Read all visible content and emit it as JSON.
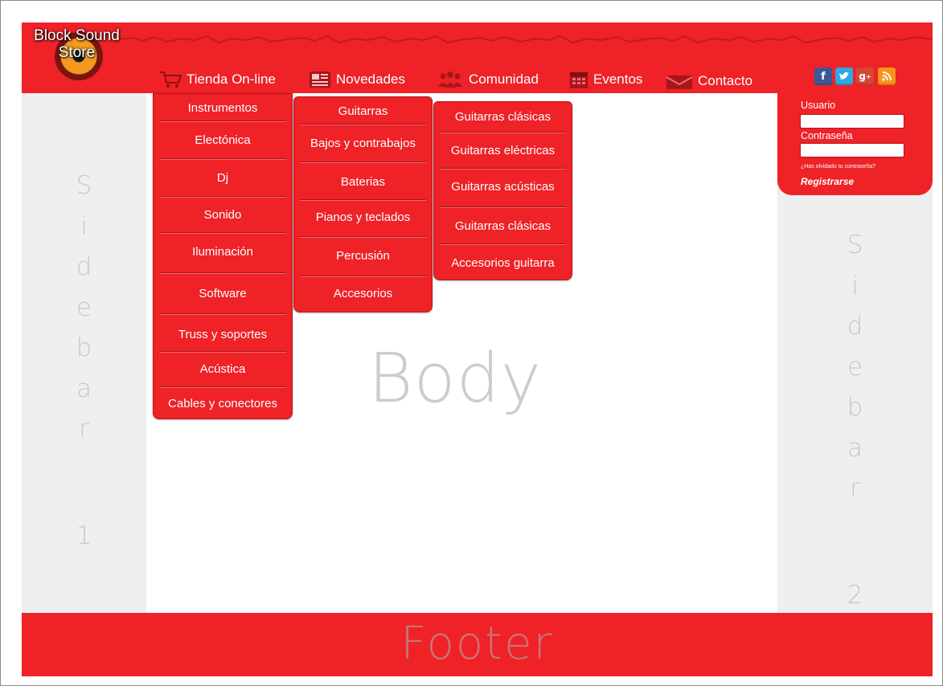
{
  "header": {
    "logo_line1": "Block Sound",
    "logo_line2": "Store",
    "nav": [
      {
        "label": "Tienda On-line",
        "icon": "shopping-cart-icon"
      },
      {
        "label": "Novedades",
        "icon": "newspaper-icon"
      },
      {
        "label": "Comunidad",
        "icon": "people-icon"
      },
      {
        "label": "Eventos",
        "icon": "calendar-icon"
      },
      {
        "label": "Contacto",
        "icon": "envelope-icon"
      }
    ],
    "social": [
      {
        "glyph": "f",
        "icon": "facebook-icon",
        "color": "#3b5998"
      },
      {
        "glyph": "t",
        "icon": "twitter-icon",
        "color": "#2ba9e1"
      },
      {
        "glyph": "g+",
        "icon": "google-plus-icon",
        "color": "#d34836"
      },
      {
        "glyph": "rss",
        "icon": "rss-icon",
        "color": "#f7941d"
      }
    ]
  },
  "menus": {
    "categories": [
      "Instrumentos",
      "Electónica",
      "Dj",
      "Sonido",
      "Iluminación",
      "Software",
      "Truss y soportes",
      "Acústica",
      "Cables y conectores"
    ],
    "instruments": [
      "Guitarras",
      "Bajos y contrabajos",
      "Baterias",
      "Pianos y teclados",
      "Percusión",
      "Accesorios"
    ],
    "guitars": [
      "Guitarras clásicas",
      "Guitarras eléctricas",
      "Guitarras acústicas",
      "Guitarras clásicas",
      "Accesorios guitarra"
    ]
  },
  "login": {
    "user_label": "Usuario",
    "password_label": "Contraseña",
    "forgot": "¿Has olvidado tu contraseña?",
    "register": "Registrarse"
  },
  "sidebar1": [
    "S",
    "i",
    "d",
    "e",
    "b",
    "a",
    "r",
    "1"
  ],
  "sidebar2": [
    "S",
    "i",
    "d",
    "e",
    "b",
    "a",
    "r",
    "2"
  ],
  "body_label": "Body",
  "footer_label": "Footer",
  "colors": {
    "brand_red": "#ee2227",
    "placeholder_gray": "#cccccc",
    "sidebar_bg": "#efefef"
  }
}
